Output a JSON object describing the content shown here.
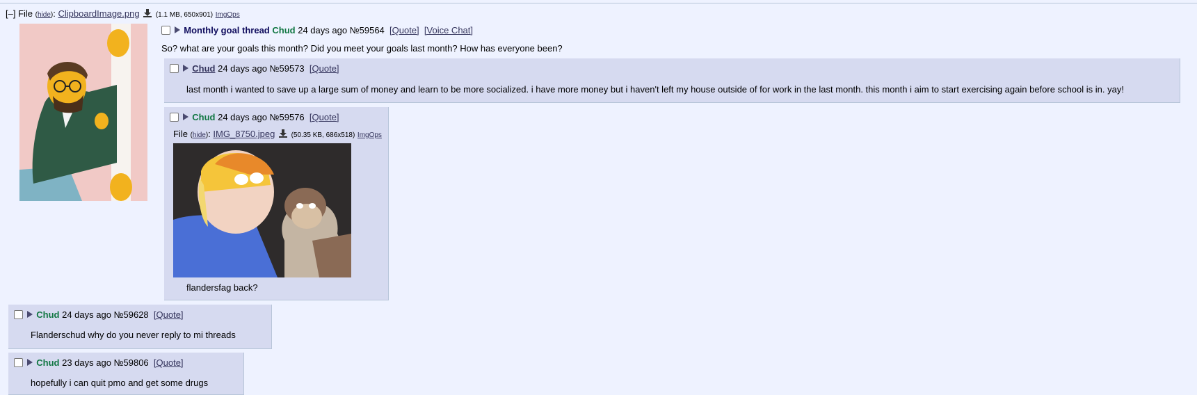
{
  "op": {
    "toggle": "[–]",
    "file_label": "File",
    "hide_label": "hide",
    "filename": "ClipboardImage.png",
    "file_info": "(1.1 MB, 650x901)",
    "imgops": "ImgOps",
    "subject": "Monthly goal thread",
    "name": "Chud",
    "date": "24 days ago",
    "post_no": "№59564",
    "quote_label": "[Quote]",
    "voice_label": "[Voice Chat]",
    "message": "So? what are your goals this month? Did you meet your goals last month? How has everyone been?"
  },
  "replies": [
    {
      "name": "Chud",
      "date": "24 days ago",
      "post_no": "№59573",
      "quote_label": "[Quote]",
      "message": "last month i wanted to save up a large sum of money and learn to be more socialized. i have more money but i haven't left my house outside of for work in the last month. this month i aim to start exercising again before school is in. yay!"
    },
    {
      "name": "Chud",
      "date": "24 days ago",
      "post_no": "№59576",
      "quote_label": "[Quote]",
      "file_label": "File",
      "hide_label": "hide",
      "filename": "IMG_8750.jpeg",
      "file_info": "(50.35 KB, 686x518)",
      "imgops": "ImgOps",
      "message": "flandersfag back?"
    },
    {
      "name": "Chud",
      "date": "24 days ago",
      "post_no": "№59628",
      "quote_label": "[Quote]",
      "message": "Flanderschud why do you never reply to mi threads"
    },
    {
      "name": "Chud",
      "date": "23 days ago",
      "post_no": "№59806",
      "quote_label": "[Quote]",
      "message": "hopefully i can quit pmo and get some drugs"
    }
  ],
  "colors": {
    "background": "#eef2ff",
    "reply_bg": "#d6daf0",
    "name": "#117743",
    "subject": "#0f0c5d"
  }
}
